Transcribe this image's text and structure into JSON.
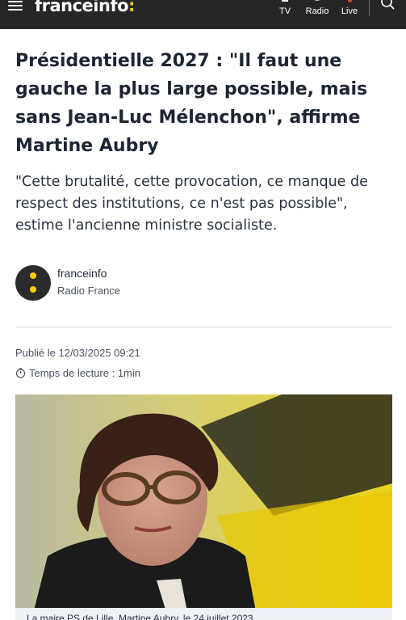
{
  "header": {
    "logo_text": "franceinfo",
    "logo_colon": ":",
    "nav": {
      "tv": "TV",
      "radio": "Radio",
      "live": "Live"
    },
    "colors": {
      "background": "#262626",
      "brand_yellow": "#ffcc00",
      "live_red": "#e4432d"
    },
    "icons": [
      "menu-icon",
      "tv-icon",
      "radio-icon",
      "live-icon",
      "search-icon"
    ]
  },
  "article": {
    "title": "Présidentielle 2027 : \"Il faut une gauche la plus large possible, mais sans Jean-Luc Mélenchon\", affirme Martine Aubry",
    "chapo": "\"Cette brutalité, cette provocation, ce manque de respect des institutions, ce n'est pas possible\", estime l'ancienne ministre socialiste.",
    "author": {
      "name": "franceinfo",
      "organization": "Radio France"
    },
    "published": "Publié le 12/03/2025 09:21",
    "reading_time": "Temps de lecture : 1min",
    "image_caption": "La maire PS de Lille, Martine Aubry, le 24 juillet 2023."
  }
}
